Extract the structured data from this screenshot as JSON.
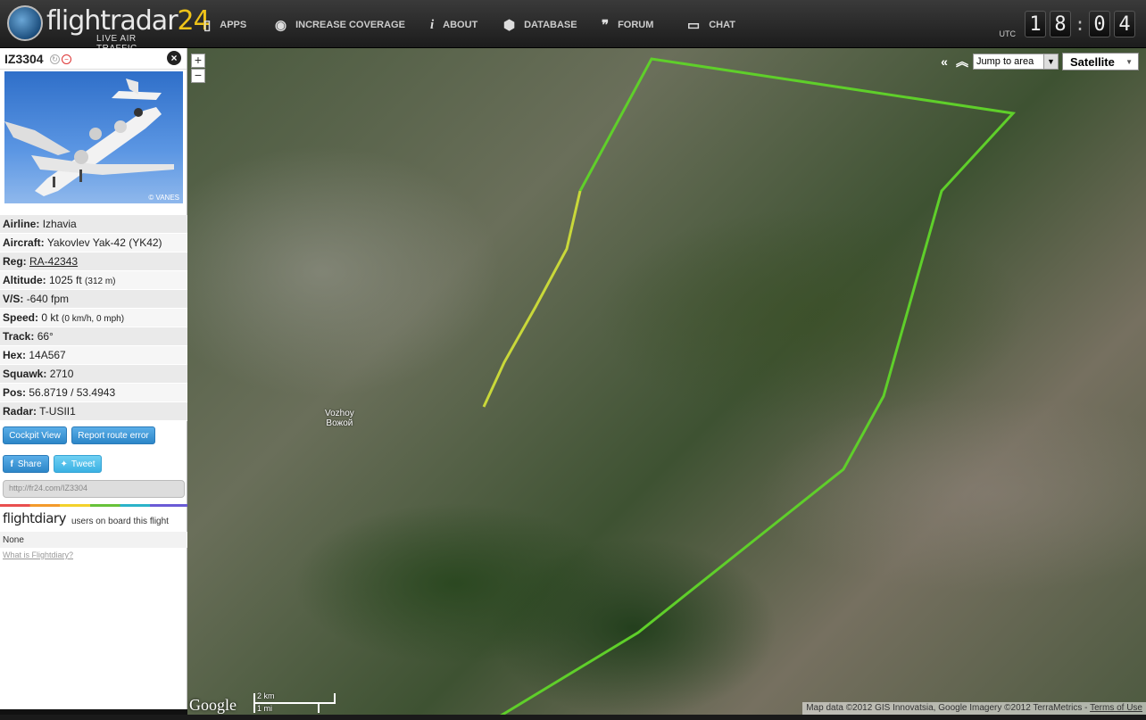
{
  "app": {
    "brand_main": "flightradar",
    "brand_num": "24",
    "tagline": "LIVE AIR TRAFFIC"
  },
  "nav": [
    {
      "label": "APPS",
      "icon": "phone-icon"
    },
    {
      "label": "INCREASE COVERAGE",
      "icon": "eye-icon"
    },
    {
      "label": "ABOUT",
      "icon": "info-icon"
    },
    {
      "label": "DATABASE",
      "icon": "database-icon"
    },
    {
      "label": "FORUM",
      "icon": "quote-icon"
    },
    {
      "label": "CHAT",
      "icon": "chat-icon"
    }
  ],
  "clock": {
    "utc_label": "UTC",
    "h1": "1",
    "h2": "8",
    "m1": "0",
    "m2": "4",
    "sep": ":"
  },
  "panel": {
    "flight": "IZ3304",
    "photo_credit": "© VANES",
    "close": "×",
    "rows": {
      "airline_label": "Airline:",
      "airline": "Izhavia",
      "aircraft_label": "Aircraft:",
      "aircraft": "Yakovlev Yak-42 (YK42)",
      "reg_label": "Reg:",
      "reg": "RA-42343",
      "altitude_label": "Altitude:",
      "altitude": "1025 ft",
      "altitude_m": "(312 m)",
      "vs_label": "V/S:",
      "vs": "-640 fpm",
      "speed_label": "Speed:",
      "speed": "0 kt",
      "speed_sub": "(0 km/h, 0 mph)",
      "track_label": "Track:",
      "track": "66°",
      "hex_label": "Hex:",
      "hex": "14A567",
      "squawk_label": "Squawk:",
      "squawk": "2710",
      "pos_label": "Pos:",
      "pos": "56.8719 / 53.4943",
      "radar_label": "Radar:",
      "radar": "T-USII1"
    },
    "buttons": {
      "cockpit": "Cockpit View",
      "report": "Report route error",
      "share": "Share",
      "tweet": "Tweet"
    },
    "url": "http://fr24.com/IZ3304",
    "flightdiary": {
      "logo": "flightdiary",
      "text": "users on board this flight",
      "none": "None",
      "what": "What is Flightdiary?"
    }
  },
  "map": {
    "zoom_in": "+",
    "zoom_out": "−",
    "jump": "Jump to area",
    "maptype": "Satellite",
    "place_latin": "Vozhoy",
    "place_cyr": "Вожой",
    "google": "Google",
    "scale_km": "2 km",
    "scale_mi": "1 mi",
    "attribution": "Map data ©2012 GIS Innovatsia, Google Imagery ©2012 TerraMetrics - ",
    "terms": "Terms of Use",
    "track_colors": {
      "green": "#5fcf2a",
      "yellow": "#c9d83a"
    }
  }
}
